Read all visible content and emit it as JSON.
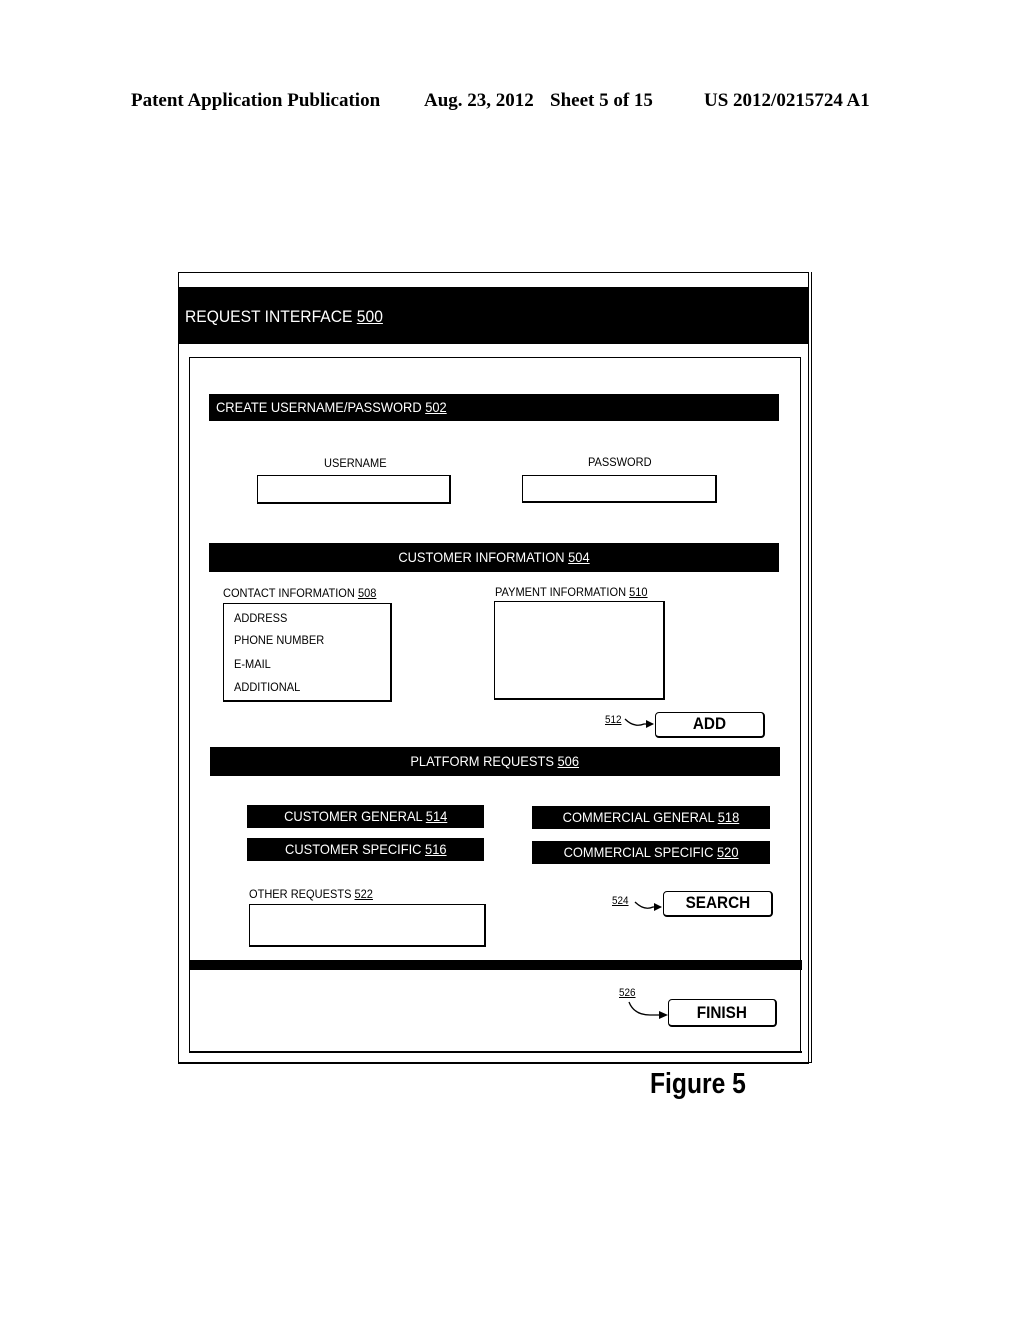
{
  "header": {
    "publication": "Patent Application Publication",
    "date_sheet": "Aug. 23, 2012",
    "sheet": "Sheet 5 of 15",
    "pub_number": "US 2012/0215724 A1"
  },
  "window": {
    "title": "REQUEST  INTERFACE",
    "title_ref": "500"
  },
  "sections": {
    "credentials": {
      "title": "CREATE USERNAME/PASSWORD",
      "ref": "502",
      "username_label": "USERNAME",
      "username_value": "",
      "password_label": "PASSWORD",
      "password_value": ""
    },
    "customer_info": {
      "title": "CUSTOMER INFORMATION",
      "ref": "504",
      "contact_label": "CONTACT INFORMATION",
      "contact_ref": "508",
      "contact_items": [
        "ADDRESS",
        "PHONE NUMBER",
        "E-MAIL",
        "ADDITIONAL"
      ],
      "payment_label": "PAYMENT INFORMATION",
      "payment_ref": "510",
      "payment_value": "",
      "add_ref": "512",
      "add_label": "ADD"
    },
    "platform_requests": {
      "title": "PLATFORM REQUESTS",
      "ref": "506",
      "buttons": [
        {
          "label": "CUSTOMER GENERAL",
          "ref": "514"
        },
        {
          "label": "CUSTOMER SPECIFIC",
          "ref": "516"
        },
        {
          "label": "COMMERCIAL GENERAL",
          "ref": "518"
        },
        {
          "label": "COMMERCIAL SPECIFIC",
          "ref": "520"
        }
      ],
      "other_label": "OTHER REQUESTS",
      "other_ref": "522",
      "other_value": "",
      "search_ref": "524",
      "search_label": "SEARCH"
    }
  },
  "footer": {
    "finish_ref": "526",
    "finish_label": "FINISH"
  },
  "figure_label": "Figure 5"
}
